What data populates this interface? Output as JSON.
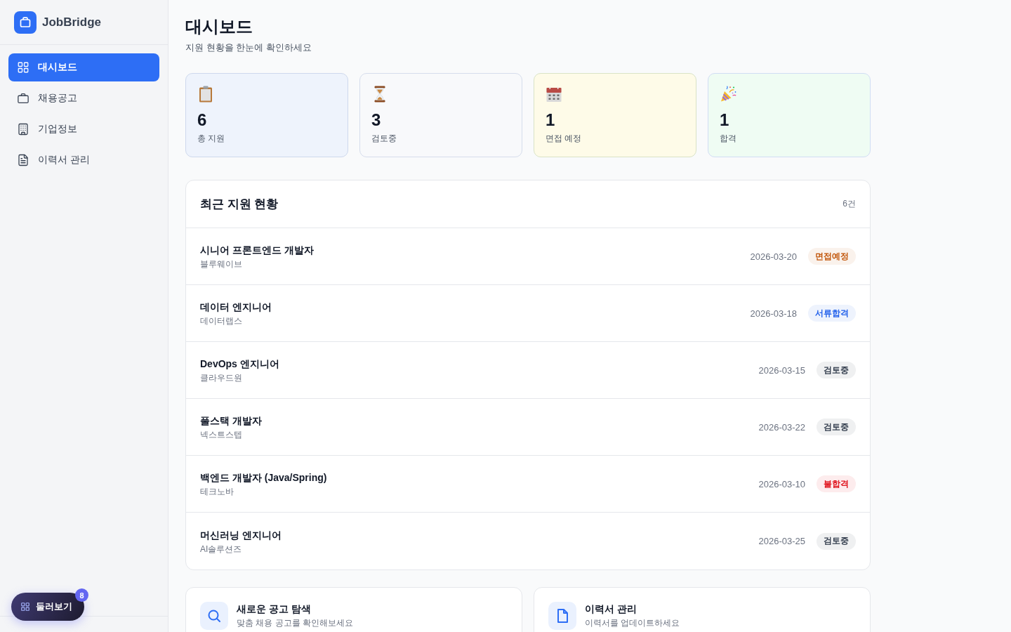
{
  "sidebar": {
    "app_name": "JobBridge",
    "nav": [
      {
        "kind": "dashboard",
        "label": "대시보드",
        "selected": true
      },
      {
        "kind": "jobs",
        "label": "채용공고",
        "selected": false
      },
      {
        "kind": "companies",
        "label": "기업정보",
        "selected": false
      },
      {
        "kind": "resume",
        "label": "이력서 관리",
        "selected": false
      }
    ]
  },
  "tour_button": {
    "label": "둘러보기",
    "badge": "8"
  },
  "header": {
    "title": "대시보드",
    "subtitle": "지원 현황을 한눈에 확인하세요"
  },
  "stats": [
    {
      "kind": "total",
      "value": "6",
      "label": "총 지원",
      "color": "#eef3fc"
    },
    {
      "kind": "review",
      "value": "3",
      "label": "검토중",
      "color": "#f8f9fb"
    },
    {
      "kind": "interview",
      "value": "1",
      "label": "면접 예정",
      "color": "#fefbe8"
    },
    {
      "kind": "offer",
      "value": "1",
      "label": "합격",
      "color": "#effcf3"
    }
  ],
  "recent": {
    "title": "최근 지원 현황",
    "count": "6건",
    "rows": [
      {
        "title": "시니어 프론트엔드 개발자",
        "company": "블루웨이브",
        "date": "2026-03-20",
        "status": "면접예정",
        "color": "#c2570c"
      },
      {
        "title": "데이터 엔지니어",
        "company": "데이터랩스",
        "date": "2026-03-18",
        "status": "서류합격",
        "color": "#2563eb"
      },
      {
        "title": "DevOps 엔지니어",
        "company": "클라우드원",
        "date": "2026-03-15",
        "status": "검토중",
        "color": "#374151"
      },
      {
        "title": "풀스택 개발자",
        "company": "넥스트스텝",
        "date": "2026-03-22",
        "status": "검토중",
        "color": "#374151"
      },
      {
        "title": "백엔드 개발자 (Java/Spring)",
        "company": "테크노바",
        "date": "2026-03-10",
        "status": "불합격",
        "color": "#e0141e"
      },
      {
        "title": "머신러닝 엔지니어",
        "company": "AI솔루션즈",
        "date": "2026-03-25",
        "status": "검토중",
        "color": "#374151"
      }
    ]
  },
  "shortcuts": [
    {
      "kind": "search",
      "title": "새로운 공고 탐색",
      "subtitle": "맞춤 채용 공고를 확인해보세요"
    },
    {
      "kind": "resume",
      "title": "이력서 관리",
      "subtitle": "이력서를 업데이트하세요"
    }
  ]
}
